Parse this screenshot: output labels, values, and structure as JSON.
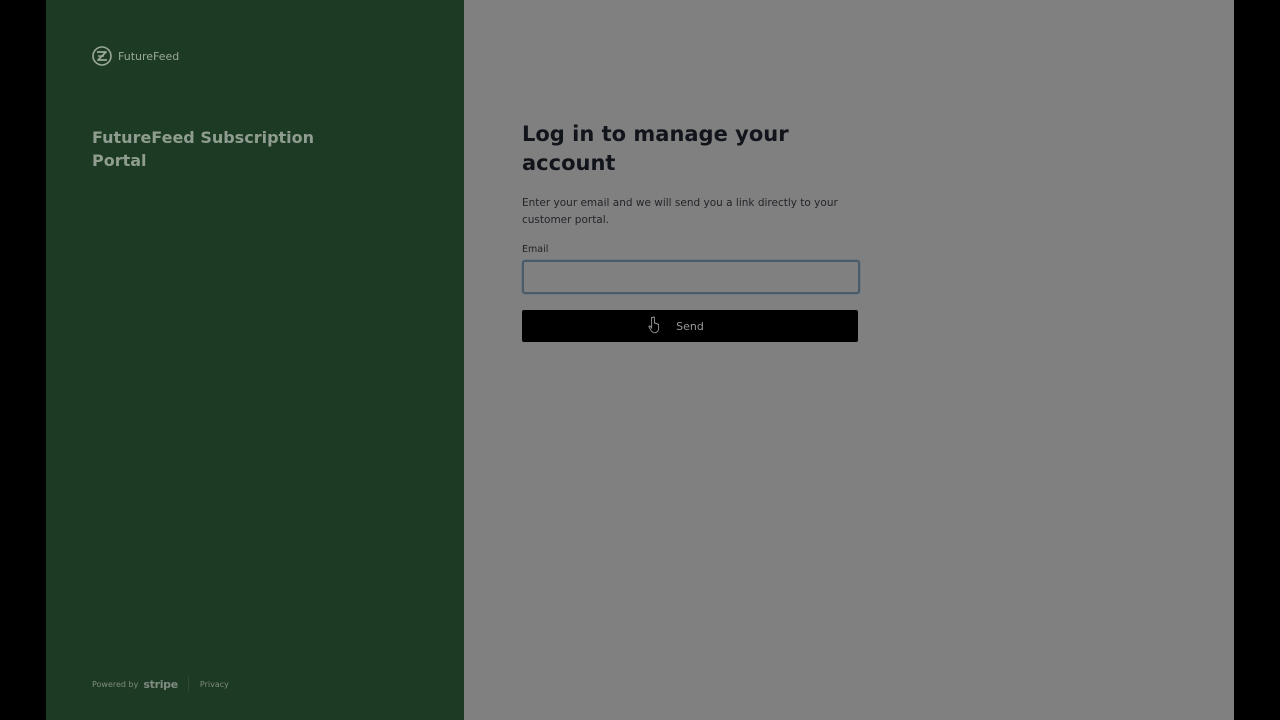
{
  "brand": {
    "name": "FutureFeed",
    "logo_icon": "futurefeed-logo-icon"
  },
  "sidebar": {
    "portal_title": "FutureFeed Subscription Portal",
    "footer": {
      "powered_by": "Powered by",
      "stripe": "stripe",
      "privacy": "Privacy"
    }
  },
  "login": {
    "heading": "Log in to manage your account",
    "description": "Enter your email and we will send you a link directly to your customer portal.",
    "email_label": "Email",
    "email_value": "",
    "email_placeholder": "",
    "send_label": "Send"
  },
  "colors": {
    "left_panel": "#1d3a24",
    "right_panel": "#808080",
    "button": "#000000"
  }
}
